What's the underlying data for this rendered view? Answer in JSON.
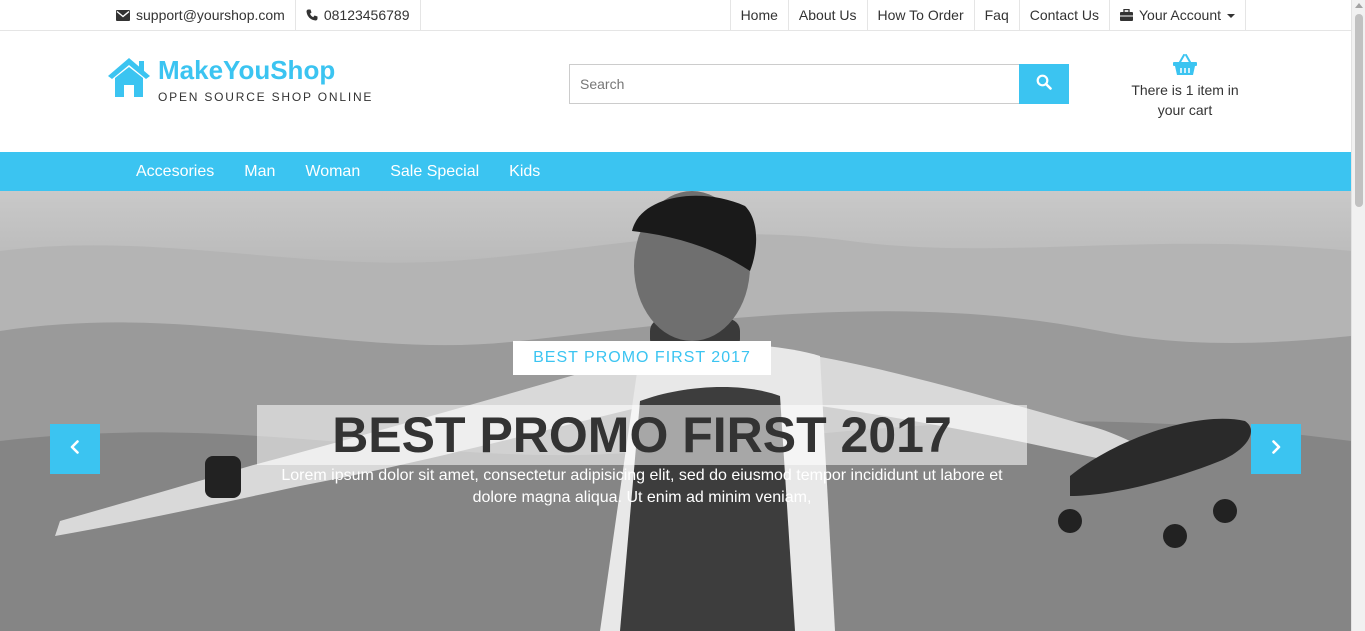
{
  "topbar": {
    "email": "support@yourshop.com",
    "phone": "08123456789",
    "links": [
      "Home",
      "About Us",
      "How To Order",
      "Faq",
      "Contact Us"
    ],
    "account": "Your Account",
    "icons": {
      "email": "envelope-icon",
      "phone": "phone-icon",
      "account": "briefcase-icon",
      "dropdown": "caret-down-icon"
    }
  },
  "brand": {
    "name": "MakeYouShop",
    "tagline": "OPEN SOURCE SHOP ONLINE",
    "icon": "home-icon"
  },
  "search": {
    "placeholder": "Search",
    "value": "",
    "icon": "search-icon"
  },
  "cart": {
    "text": "There is 1 item in your cart",
    "icon": "shopping-basket-icon"
  },
  "nav": {
    "items": [
      "Accesories",
      "Man",
      "Woman",
      "Sale Special",
      "Kids"
    ]
  },
  "hero": {
    "tag": "BEST PROMO FIRST 2017",
    "headline": "BEST PROMO FIRST 2017",
    "description": "Lorem ipsum dolor sit amet, consectetur adipisicing elit, sed do eiusmod tempor incididunt ut labore et dolore magna aliqua. Ut enim ad minim veniam,",
    "prev_icon": "chevron-left-icon",
    "next_icon": "chevron-right-icon"
  },
  "colors": {
    "accent": "#3bc4f1",
    "text": "#333333",
    "white": "#ffffff"
  }
}
